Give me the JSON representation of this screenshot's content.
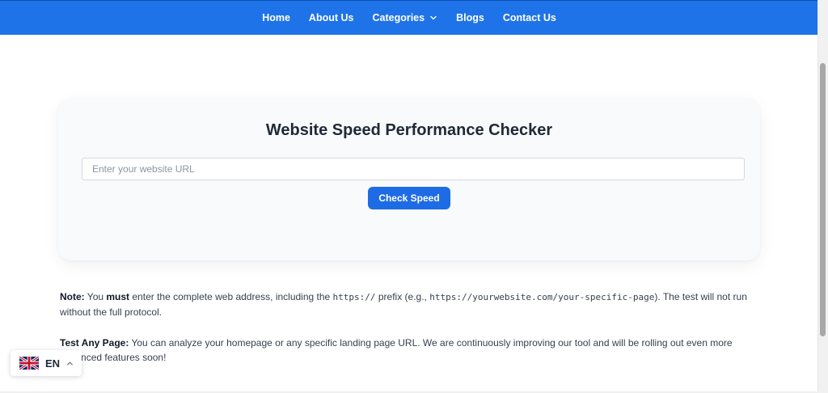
{
  "nav": {
    "items": [
      {
        "label": "Home"
      },
      {
        "label": "About Us"
      },
      {
        "label": "Categories"
      },
      {
        "label": "Blogs"
      },
      {
        "label": "Contact Us"
      }
    ],
    "bg_color": "#1e73e8"
  },
  "checker": {
    "title": "Website Speed Performance Checker",
    "url_placeholder": "Enter your website URL",
    "url_value": "",
    "button_label": "Check Speed",
    "button_color": "#1e6be6"
  },
  "notes": {
    "note1": {
      "label": "Note:",
      "t1": " You ",
      "must": "must",
      "t2": " enter the complete web address, including the ",
      "prefix": "https://",
      "t3": " prefix (e.g., ",
      "example": "https://yourwebsite.com/your-specific-page",
      "t4": "). The test will not run without the full protocol."
    },
    "note2": {
      "label": "Test Any Page:",
      "text": " You can analyze your homepage or any specific landing page URL. We are continuously improving our tool and will be rolling out even more advanced features soon!"
    }
  },
  "language": {
    "code": "EN",
    "flag_icon": "uk-flag-icon"
  }
}
